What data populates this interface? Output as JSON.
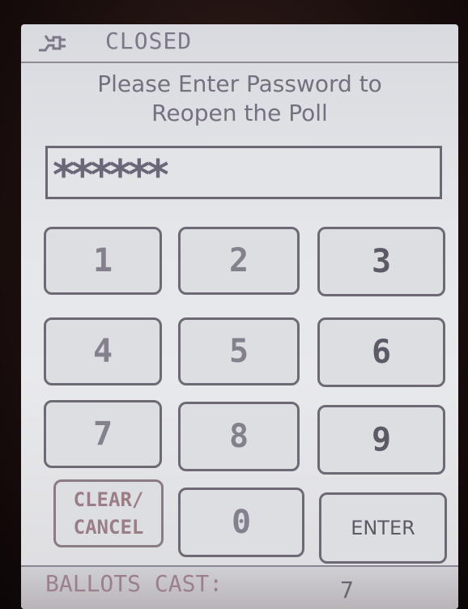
{
  "status": {
    "icon": "power-plug-icon",
    "text": "CLOSED"
  },
  "prompt": {
    "line1": "Please Enter Password to",
    "line2": "Reopen the Poll"
  },
  "password": {
    "value": "******"
  },
  "keypad": {
    "k1": "1",
    "k2": "2",
    "k3": "3",
    "k4": "4",
    "k5": "5",
    "k6": "6",
    "k7": "7",
    "k8": "8",
    "k9": "9",
    "k0": "0",
    "clear_line1": "CLEAR/",
    "clear_line2": "CANCEL",
    "enter": "ENTER"
  },
  "footer": {
    "label": "BALLOTS CAST:",
    "value": "7"
  }
}
